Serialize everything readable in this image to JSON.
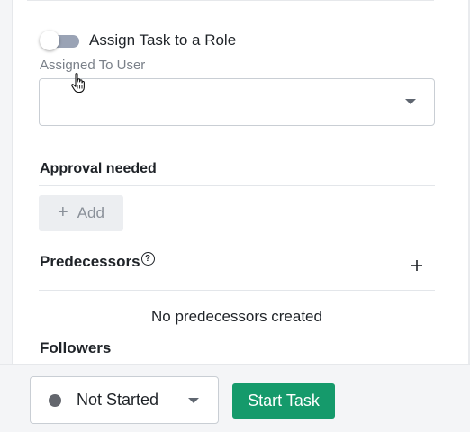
{
  "assignment": {
    "toggle_label": "Assign Task to a Role",
    "toggle_on": false,
    "assigned_to_label": "Assigned To User",
    "assigned_to_value": ""
  },
  "approval": {
    "title": "Approval needed",
    "add_label": "Add"
  },
  "predecessors": {
    "title": "Predecessors",
    "help_glyph": "?",
    "empty_text": "No predecessors created"
  },
  "followers": {
    "title": "Followers"
  },
  "footer": {
    "status_label": "Not Started",
    "start_label": "Start Task"
  },
  "colors": {
    "primary_button": "#159a6b",
    "toggle_track": "#9aa3b5",
    "status_dot": "#63666d"
  },
  "icons": {
    "toggle": "toggle-switch-off",
    "caret": "chevron-down-icon",
    "add": "plus-icon",
    "help": "help-circle-icon",
    "cursor": "hand-pointer-cursor"
  }
}
